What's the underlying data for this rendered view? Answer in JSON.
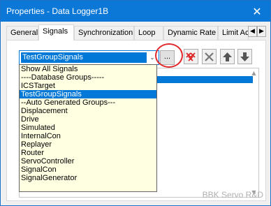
{
  "window": {
    "title": "Properties - Data Logger1B",
    "close_glyph": "✕"
  },
  "tabs": [
    {
      "label": "General",
      "active": false
    },
    {
      "label": "Signals",
      "active": true
    },
    {
      "label": "Synchronization",
      "active": false
    },
    {
      "label": "Loop",
      "active": false
    },
    {
      "label": "Dynamic Rate",
      "active": false
    },
    {
      "label": "Limit Act",
      "active": false
    }
  ],
  "tab_scroll": {
    "left_glyph": "◀",
    "right_glyph": "▶"
  },
  "combo": {
    "value": "TestGroupSignals",
    "arrow_glyph": "⌄"
  },
  "browse_button": {
    "label": "..."
  },
  "toolbar": {
    "buttons": [
      {
        "icon": "delete-all-icon"
      },
      {
        "icon": "delete-icon"
      },
      {
        "icon": "move-up-icon"
      },
      {
        "icon": "move-down-icon"
      }
    ]
  },
  "dropdown": {
    "items": [
      {
        "label": "Show All Signals",
        "selected": false
      },
      {
        "label": "----Database Groups-----",
        "selected": false
      },
      {
        "label": "ICSTarget",
        "selected": false
      },
      {
        "label": "TestGroupSignals",
        "selected": true
      },
      {
        "label": "--Auto Generated Groups---",
        "selected": false
      },
      {
        "label": "Displacement",
        "selected": false
      },
      {
        "label": "Drive",
        "selected": false
      },
      {
        "label": "Simulated",
        "selected": false
      },
      {
        "label": "InternalCon",
        "selected": false
      },
      {
        "label": "Replayer",
        "selected": false
      },
      {
        "label": "Router",
        "selected": false
      },
      {
        "label": "ServoController",
        "selected": false
      },
      {
        "label": "SignalCon",
        "selected": false
      },
      {
        "label": "SignalGenerator",
        "selected": false
      }
    ]
  },
  "list": {
    "scroll_up_glyph": "▲",
    "scroll_down_glyph": "▼"
  },
  "watermark": "BBK Servo R&D",
  "colors": {
    "title_bar": "#0b78d7",
    "selection": "#0078d7",
    "dropdown_bg": "#ffffe1",
    "highlight_circle": "#e0282a"
  }
}
